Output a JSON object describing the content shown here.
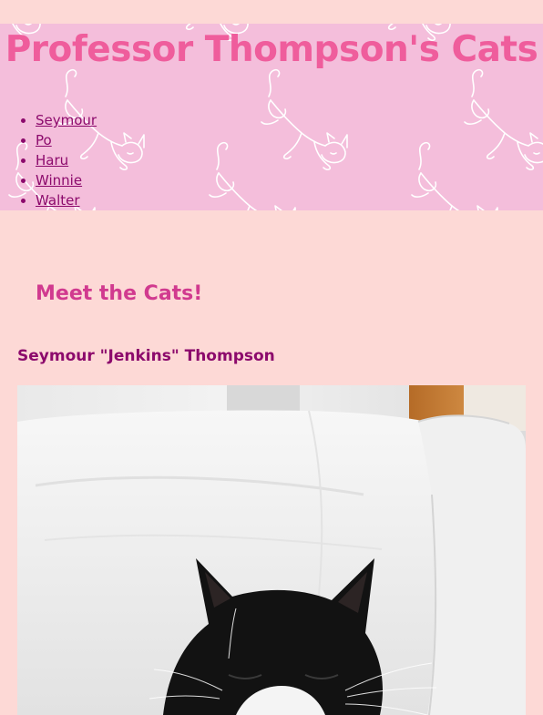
{
  "header": {
    "title": "Professor Thompson's Cats",
    "background_color": "#f4bedb",
    "title_color": "#ef5d9c",
    "pattern_icon": "stretching-cat-icon"
  },
  "nav": {
    "items": [
      {
        "label": "Seymour"
      },
      {
        "label": "Po"
      },
      {
        "label": "Haru"
      },
      {
        "label": "Winnie"
      },
      {
        "label": "Walter"
      }
    ],
    "link_color": "#8c0a6c"
  },
  "main": {
    "section_heading": "Meet the Cats!",
    "cats": [
      {
        "name": "Seymour \"Jenkins\" Thompson",
        "photo": "black-and-white-cat-on-white-couch"
      }
    ]
  },
  "page": {
    "background_color": "#fdd9d6"
  }
}
